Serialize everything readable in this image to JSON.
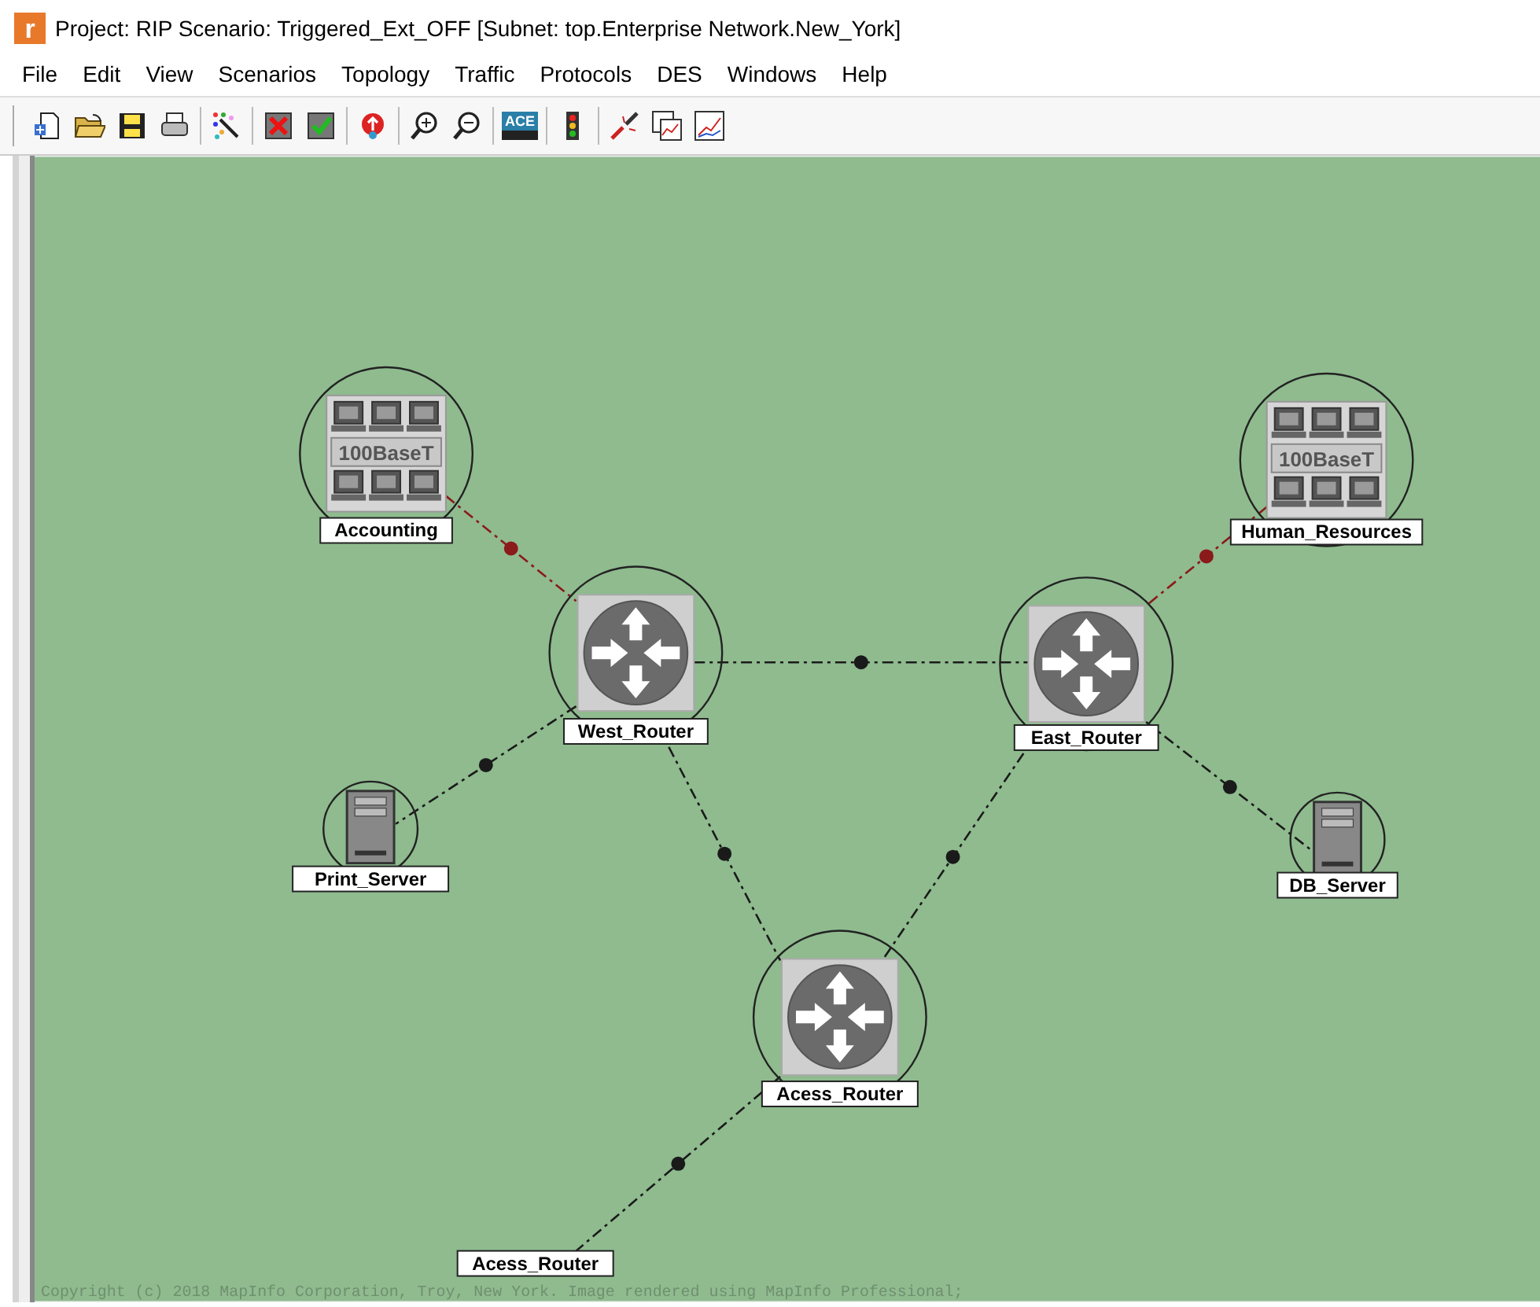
{
  "window": {
    "logo_letter": "r",
    "title": "Project: RIP Scenario: Triggered_Ext_OFF  [Subnet: top.Enterprise Network.New_York]"
  },
  "menu": [
    "File",
    "Edit",
    "View",
    "Scenarios",
    "Topology",
    "Traffic",
    "Protocols",
    "DES",
    "Windows",
    "Help"
  ],
  "toolbar": {
    "ace_label": "ACE"
  },
  "canvas": {
    "nodes": [
      {
        "kind": "lan",
        "name": "Accounting",
        "icon_text": "100BaseT"
      },
      {
        "kind": "lan",
        "name": "Human_Resources",
        "icon_text": "100BaseT"
      },
      {
        "kind": "router",
        "name": "West_Router"
      },
      {
        "kind": "router",
        "name": "East_Router"
      },
      {
        "kind": "server",
        "name": "Print_Server"
      },
      {
        "kind": "server",
        "name": "DB_Server"
      },
      {
        "kind": "router",
        "name": "Acess_Router"
      },
      {
        "kind": "stub",
        "name": "Acess_Router"
      }
    ],
    "links": [
      {
        "color": "#8b1a1a"
      },
      {
        "color": "#8b1a1a"
      },
      {
        "color": "#1a1a1a"
      },
      {
        "color": "#1a1a1a"
      },
      {
        "color": "#1a1a1a"
      },
      {
        "color": "#1a1a1a"
      },
      {
        "color": "#1a1a1a"
      },
      {
        "color": "#1a1a1a"
      }
    ],
    "copyright": "Copyright (c) 2018 MapInfo Corporation, Troy, New York. Image rendered using MapInfo Professional;"
  }
}
